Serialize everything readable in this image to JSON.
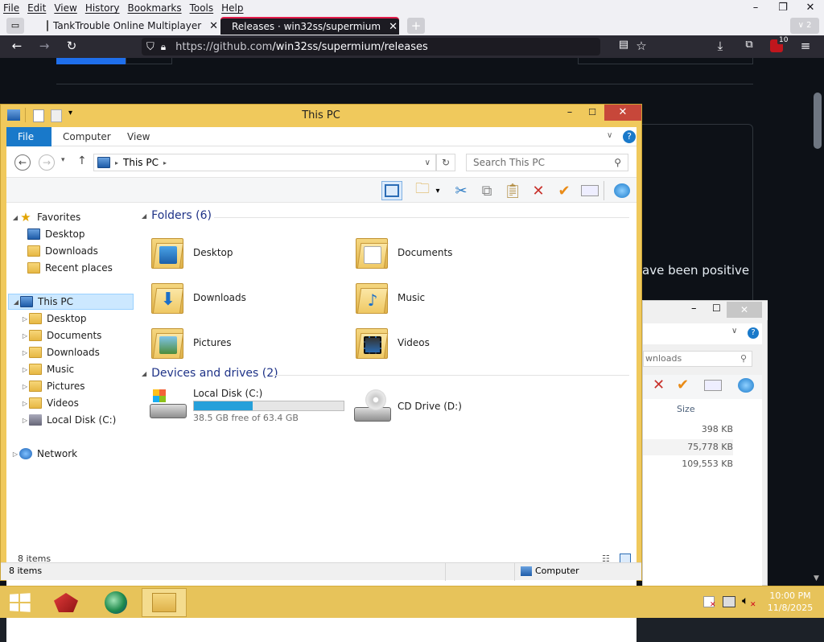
{
  "browser": {
    "menu": [
      "File",
      "Edit",
      "View",
      "History",
      "Bookmarks",
      "Tools",
      "Help"
    ],
    "tabs": [
      {
        "label": "TankTrouble Online Multiplayer",
        "active": false
      },
      {
        "label": "Releases · win32ss/supermium",
        "active": true
      }
    ],
    "tab_overflow_count": "2",
    "url_host": "https://github.com",
    "url_path": "/win32ss/supermium/releases",
    "extension_badge": "10",
    "page_snippet": "ave been positive"
  },
  "explorer": {
    "title": "This PC",
    "ribbon_tabs": [
      "File",
      "Computer",
      "View"
    ],
    "breadcrumb": "This PC",
    "search_placeholder": "Search This PC",
    "nav": {
      "favorites_header": "Favorites",
      "favorites": [
        "Desktop",
        "Downloads",
        "Recent places"
      ],
      "thispc_header": "This PC",
      "thispc_items": [
        "Desktop",
        "Documents",
        "Downloads",
        "Music",
        "Pictures",
        "Videos",
        "Local Disk (C:)"
      ],
      "network": "Network"
    },
    "folders_group": "Folders (6)",
    "folders": [
      "Desktop",
      "Documents",
      "Downloads",
      "Music",
      "Pictures",
      "Videos"
    ],
    "drives_group": "Devices and drives (2)",
    "drives": [
      {
        "name": "Local Disk (C:)",
        "free": "38.5 GB free of 63.4 GB",
        "used_fraction": 0.39
      },
      {
        "name": "CD Drive (D:)"
      }
    ],
    "item_count": "8 items",
    "status_count": "8 items",
    "status_location": "Computer"
  },
  "explorer2": {
    "search_placeholder": "wnloads",
    "size_header": "Size",
    "sizes": [
      "398 KB",
      "75,778 KB",
      "109,553 KB"
    ]
  },
  "clock": {
    "time": "10:00 PM",
    "date": "11/8/2025"
  }
}
